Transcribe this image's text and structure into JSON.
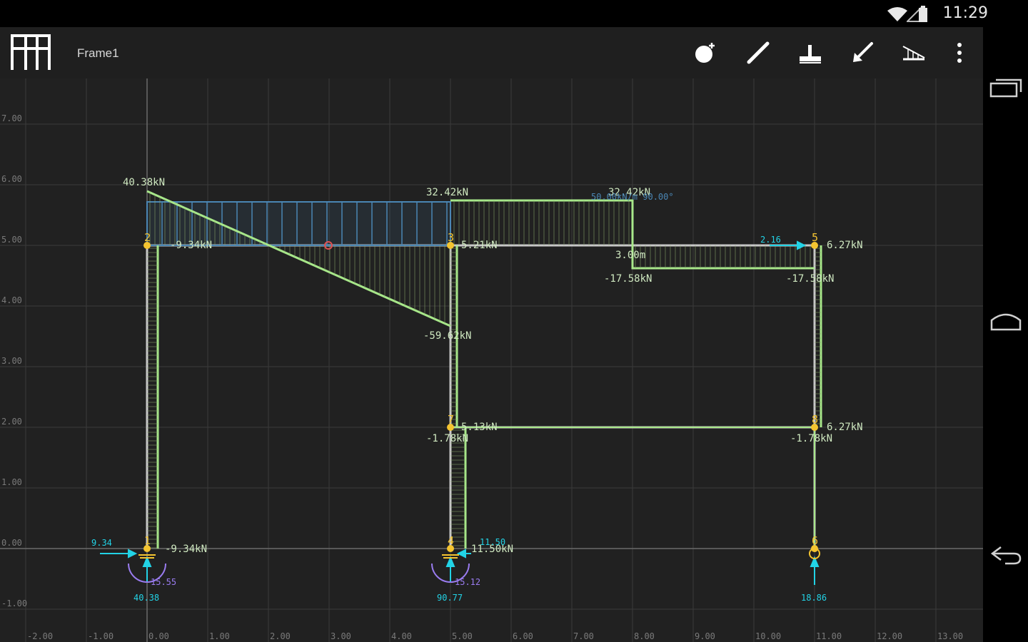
{
  "status_bar": {
    "time": "11:29"
  },
  "toolbar": {
    "title": "Frame1",
    "buttons": [
      "add-node",
      "draw-member",
      "add-support",
      "add-load",
      "add-distributed-load",
      "more"
    ]
  },
  "colors": {
    "background": "#212121",
    "grid": "#3a3a3a",
    "structure": "#c8c8c8",
    "diagram": "#a8e88a",
    "distributed_load": "#4a86b4",
    "node": "#f4c430",
    "reaction": "#22d3e6",
    "moment": "#9a7cf0",
    "axis_label": "#7a7a7a"
  },
  "axis_labels": {
    "y": [
      "7.00",
      "6.00",
      "5.00",
      "4.00",
      "3.00",
      "2.00",
      "1.00",
      "0.00",
      "-1.00"
    ],
    "x": [
      "-2.00",
      "-1.00",
      "0.00",
      "1.00",
      "2.00",
      "3.00",
      "4.00",
      "5.00",
      "6.00",
      "7.00",
      "8.00",
      "9.00",
      "10.00",
      "11.00",
      "12.00",
      "13.00"
    ]
  },
  "nodes": [
    {
      "id": "1",
      "x": 0,
      "y": 0
    },
    {
      "id": "2",
      "x": 0,
      "y": 5
    },
    {
      "id": "3",
      "x": 5,
      "y": 5
    },
    {
      "id": "4",
      "x": 5,
      "y": 0
    },
    {
      "id": "5",
      "x": 11,
      "y": 5
    },
    {
      "id": "6",
      "x": 11,
      "y": 0
    },
    {
      "id": "7",
      "x": 5,
      "y": 2
    },
    {
      "id": "8",
      "x": 11,
      "y": 2
    }
  ],
  "diagram_labels": {
    "v_40_38": "40.38kN",
    "v_32_42_a": "32.42kN",
    "v_32_42_b": "32.42kN",
    "v_m9_34_top": "-9.34kN",
    "v_5_2": "5.21kN",
    "v_m59_6": "-59.62kN",
    "v_m17_58_a": "-17.58kN",
    "v_m17_58_b": "-17.58kN",
    "v_6_27_top": "6.27kN",
    "v_6_27_mid": "6.27kN",
    "v_m1_78_a": "-1.78kN",
    "v_m1_78_b": "-1.78kN",
    "v_5_mid": "5.13kN",
    "v_m9_34_bot": "-9.34kN",
    "v_11_5": "11.50kN",
    "dim_3": "3.00m",
    "load_info": "50.00kN/m 90.00°"
  },
  "reaction_labels": {
    "h1": "9.34",
    "m1": "15.55",
    "v1": "40.38",
    "h4": "11.50",
    "m4": "15.12",
    "v4": "90.77",
    "v6": "18.86",
    "h5": "2.16"
  }
}
